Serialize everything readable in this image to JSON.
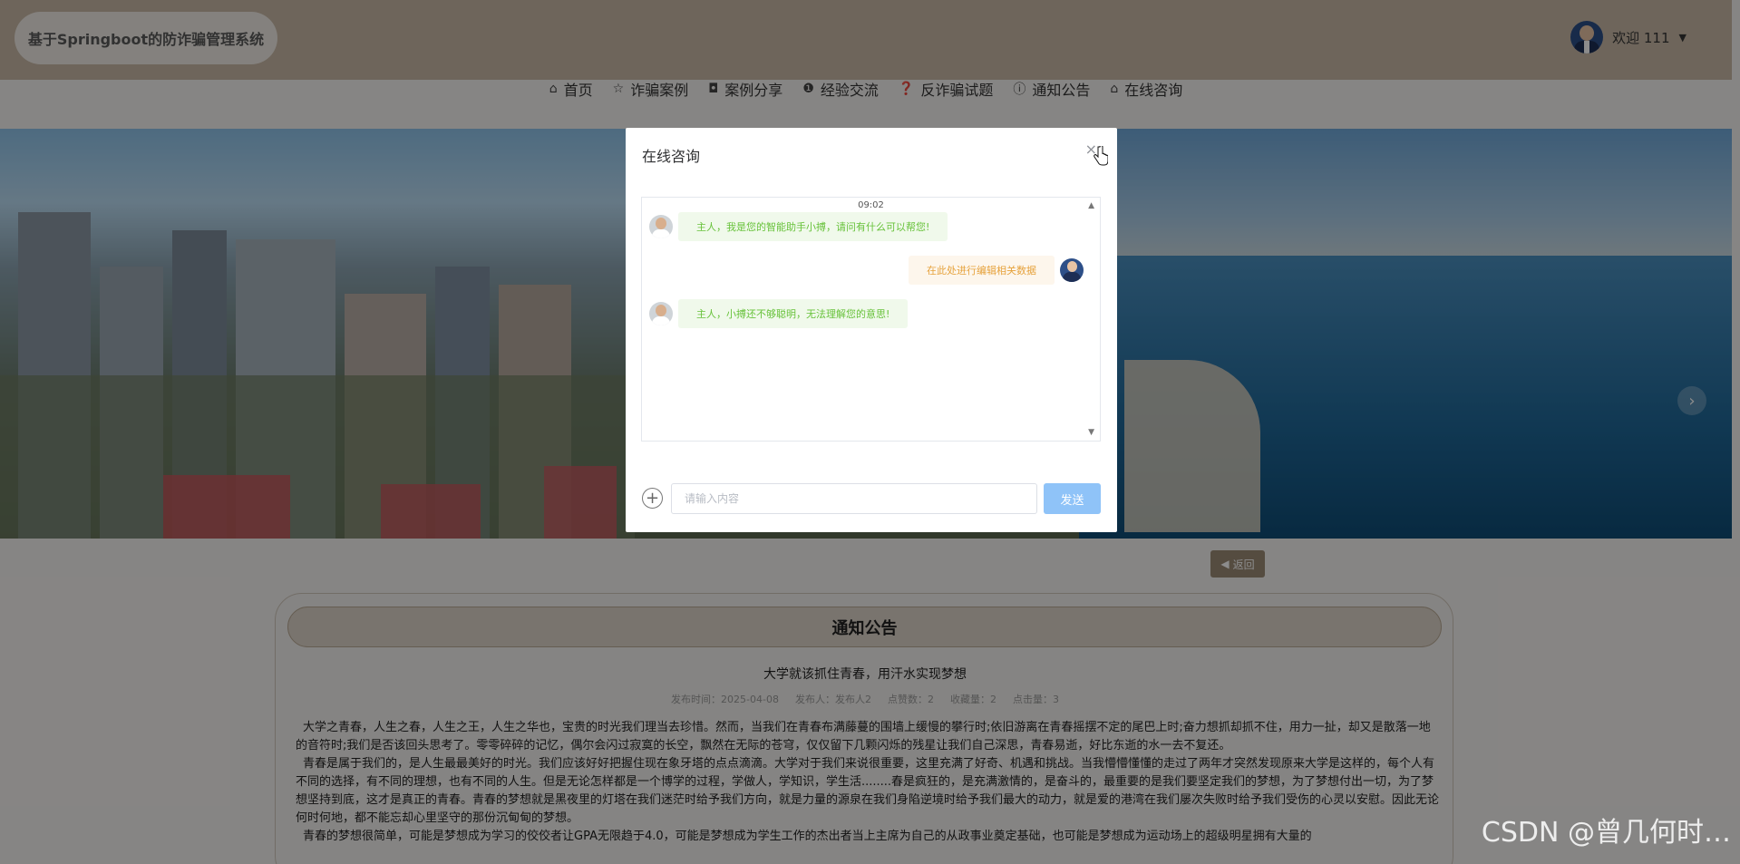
{
  "app": {
    "brand": "基于Springboot的防诈骗管理系统",
    "user_greeting": "欢迎 111"
  },
  "nav": [
    {
      "label": "首页",
      "icon": "home-icon",
      "glyph": "⌂"
    },
    {
      "label": "诈骗案例",
      "icon": "star-icon",
      "glyph": "☆"
    },
    {
      "label": "案例分享",
      "icon": "bag-icon",
      "glyph": "◘"
    },
    {
      "label": "经验交流",
      "icon": "warning-icon",
      "glyph": "❶"
    },
    {
      "label": "反诈骗试题",
      "icon": "question-icon",
      "glyph": "❓"
    },
    {
      "label": "通知公告",
      "icon": "info-icon",
      "glyph": "ⓘ"
    },
    {
      "label": "在线咨询",
      "icon": "home-icon",
      "glyph": "⌂"
    }
  ],
  "back_label": "返回",
  "notice": {
    "heading": "通知公告",
    "title": "大学就该抓住青春，用汗水实现梦想",
    "meta": [
      "发布时间：2025-04-08",
      "发布人：发布人2",
      "点赞数：2",
      "收藏量：2",
      "点击量：3"
    ],
    "paragraphs": [
      "大学之青春，人生之春，人生之王，人生之华也，宝贵的时光我们理当去珍惜。然而，当我们在青春布满藤蔓的围墙上缓慢的攀行时;依旧游离在青春摇摆不定的尾巴上时;奋力想抓却抓不住，用力一扯，却又是散落一地的音符时;我们是否该回头思考了。零零碎碎的记忆，偶尔会闪过寂寞的长空，飘然在无际的苍穹，仅仅留下几颗闪烁的残星让我们自己深思，青春易逝，好比东逝的水一去不复还。",
      "青春是属于我们的，是人生最最美好的时光。我们应该好好把握住现在象牙塔的点点滴滴。大学对于我们来说很重要，这里充满了好奇、机遇和挑战。当我懵懵懂懂的走过了两年才突然发现原来大学是这样的，每个人有不同的选择，有不同的理想，也有不同的人生。但是无论怎样都是一个博学的过程，学做人，学知识，学生活........春是疯狂的，是充满激情的，是奋斗的，最重要的是我们要坚定我们的梦想，为了梦想付出一切，为了梦想坚持到底，这才是真正的青春。青春的梦想就是黑夜里的灯塔在我们迷茫时给予我们方向，就是力量的源泉在我们身陷逆境时给予我们最大的动力，就是爱的港湾在我们屡次失败时给予我们受伤的心灵以安慰。因此无论何时何地，都不能忘却心里坚守的那份沉甸甸的梦想。",
      "青春的梦想很简单，可能是梦想成为学习的佼佼者让GPA无限趋于4.0，可能是梦想成为学生工作的杰出者当上主席为自己的从政事业奠定基础，也可能是梦想成为运动场上的超级明星拥有大量的"
    ]
  },
  "modal": {
    "title": "在线咨询",
    "close": "×",
    "time": "09:02",
    "messages": [
      {
        "from": "bot",
        "text": "主人，我是您的智能助手小搏，请问有什么可以帮您!"
      },
      {
        "from": "me",
        "text": "在此处进行编辑相关数据"
      },
      {
        "from": "bot",
        "text": "主人，小搏还不够聪明，无法理解您的意思!"
      }
    ],
    "input_placeholder": "请输入内容",
    "send_label": "发送"
  },
  "watermark": "CSDN @曾几何时…",
  "colors": {
    "topbar": "#c8b9a6",
    "send_button": "#8fc3f8",
    "bot_bubble_text": "#67c23a",
    "me_bubble_text": "#e6a23c"
  }
}
